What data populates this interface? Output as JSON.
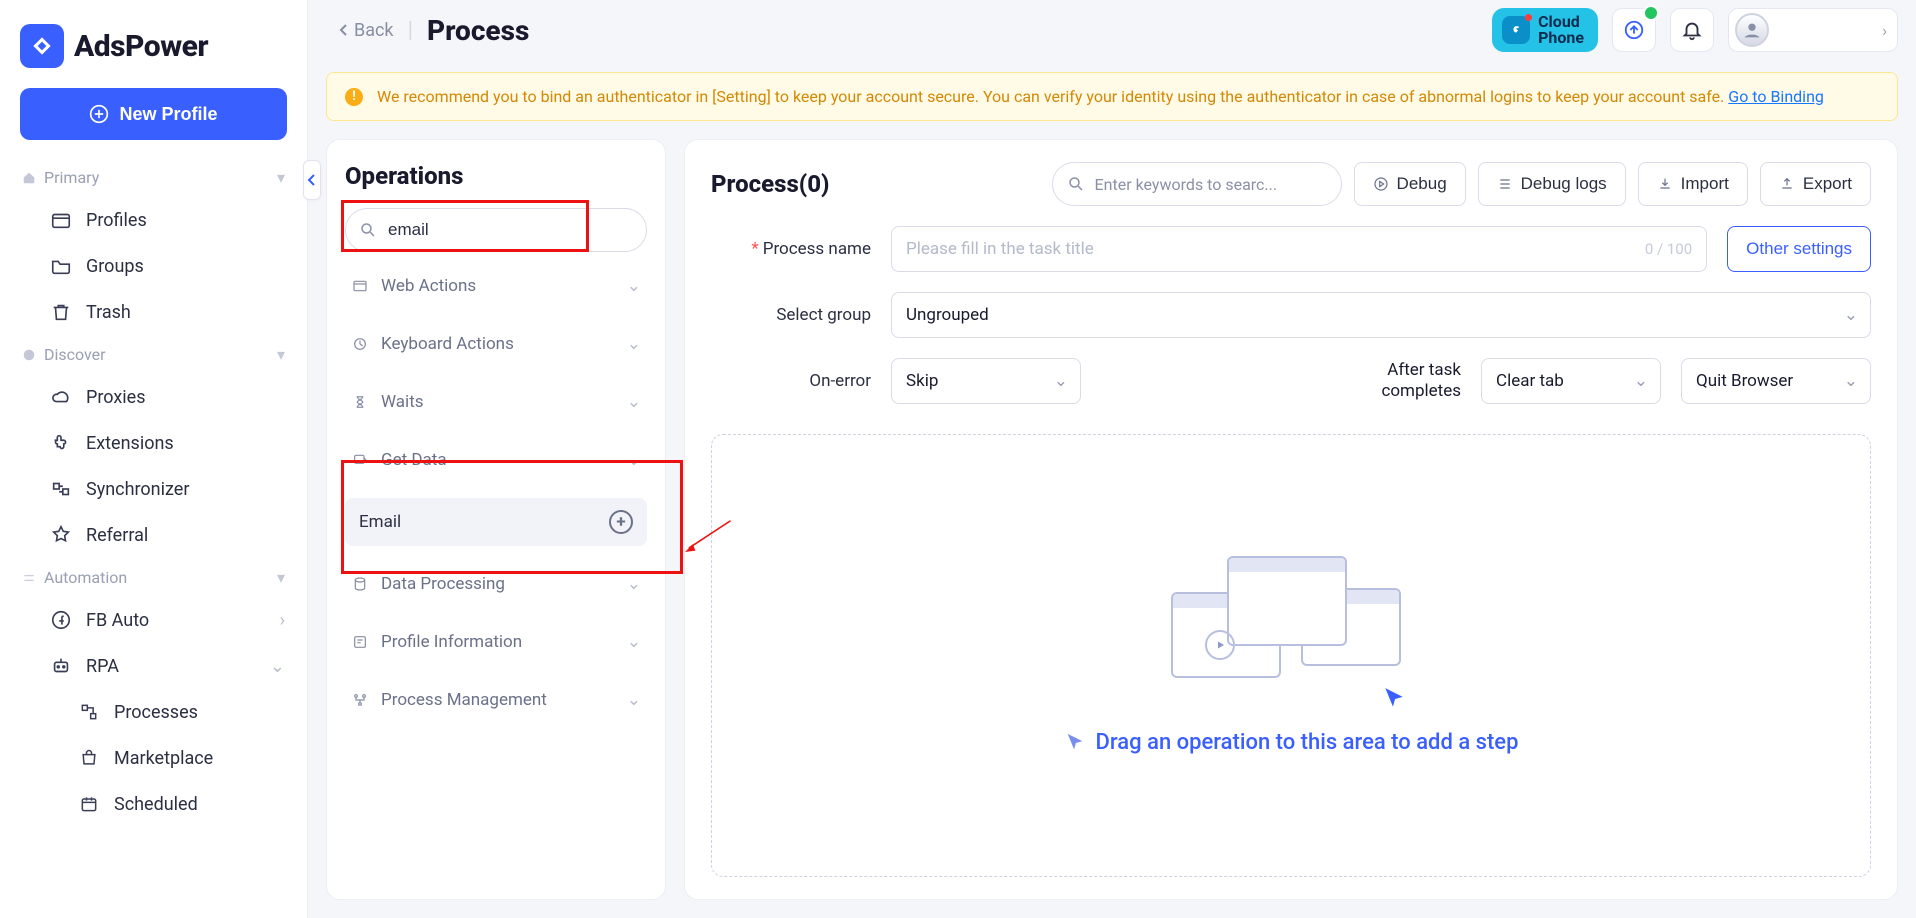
{
  "brand": "AdsPower",
  "new_profile_label": "New Profile",
  "sidebar": {
    "sections": [
      {
        "label": "Primary",
        "items": [
          {
            "label": "Profiles"
          },
          {
            "label": "Groups"
          },
          {
            "label": "Trash"
          }
        ]
      },
      {
        "label": "Discover",
        "items": [
          {
            "label": "Proxies"
          },
          {
            "label": "Extensions"
          },
          {
            "label": "Synchronizer"
          },
          {
            "label": "Referral"
          }
        ]
      },
      {
        "label": "Automation",
        "items": [
          {
            "label": "FB Auto",
            "right_chevron": true
          },
          {
            "label": "RPA",
            "expandable": true,
            "children": [
              {
                "label": "Processes"
              },
              {
                "label": "Marketplace"
              },
              {
                "label": "Scheduled"
              }
            ]
          }
        ]
      }
    ]
  },
  "header": {
    "back": "Back",
    "title": "Process",
    "cloudphone_l1": "Cloud",
    "cloudphone_l2": "Phone"
  },
  "alert": {
    "text": "We recommend you to bind an authenticator in [Setting] to keep your account secure. You can verify your identity using the authenticator in case of abnormal logins to keep your account safe. ",
    "link": "Go to Binding"
  },
  "operations": {
    "title": "Operations",
    "search_value": "email",
    "groups": [
      {
        "label": "Web Actions"
      },
      {
        "label": "Keyboard Actions"
      },
      {
        "label": "Waits"
      },
      {
        "label": "Get Data",
        "children": [
          {
            "label": "Email"
          }
        ]
      },
      {
        "label": "Data Processing"
      },
      {
        "label": "Profile Information"
      },
      {
        "label": "Process Management"
      }
    ]
  },
  "process": {
    "title": "Process(0)",
    "search_placeholder": "Enter keywords to searc...",
    "debug": "Debug",
    "debug_logs": "Debug logs",
    "import": "Import",
    "export": "Export",
    "form": {
      "name_label": "Process name",
      "name_placeholder": "Please fill in the task title",
      "name_counter": "0 / 100",
      "other_settings": "Other settings",
      "group_label": "Select group",
      "group_value": "Ungrouped",
      "on_error_label": "On-error",
      "on_error_value": "Skip",
      "after_label_l1": "After task",
      "after_label_l2": "completes",
      "after_value1": "Clear tab",
      "after_value2": "Quit Browser"
    },
    "drop_text": "Drag an operation to this area to add a step"
  }
}
